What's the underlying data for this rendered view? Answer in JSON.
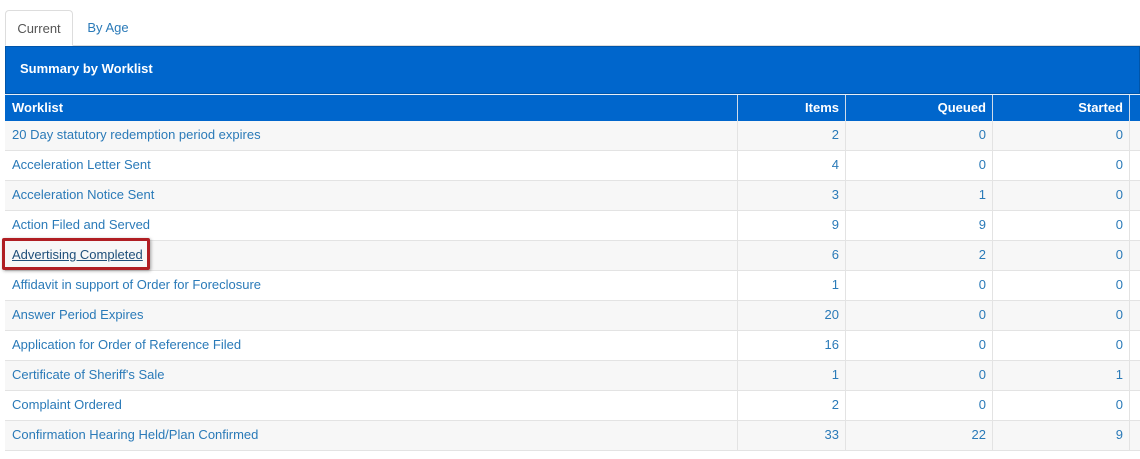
{
  "tabs": [
    {
      "label": "Current",
      "active": true
    },
    {
      "label": "By Age",
      "active": false
    }
  ],
  "panel": {
    "title": "Summary by Worklist"
  },
  "columns": [
    "Worklist",
    "Items",
    "Queued",
    "Started"
  ],
  "rows": [
    {
      "worklist": "20 Day statutory redemption period expires",
      "items": "2",
      "queued": "0",
      "started": "0"
    },
    {
      "worklist": "Acceleration Letter Sent",
      "items": "4",
      "queued": "0",
      "started": "0"
    },
    {
      "worklist": "Acceleration Notice Sent",
      "items": "3",
      "queued": "1",
      "started": "0"
    },
    {
      "worklist": "Action Filed and Served",
      "items": "9",
      "queued": "9",
      "started": "0"
    },
    {
      "worklist": "Advertising Completed",
      "items": "6",
      "queued": "2",
      "started": "0",
      "highlighted": true
    },
    {
      "worklist": "Affidavit in support of Order for Foreclosure",
      "items": "1",
      "queued": "0",
      "started": "0"
    },
    {
      "worklist": "Answer Period Expires",
      "items": "20",
      "queued": "0",
      "started": "0"
    },
    {
      "worklist": "Application for Order of Reference Filed",
      "items": "16",
      "queued": "0",
      "started": "0"
    },
    {
      "worklist": "Certificate of Sheriff's Sale",
      "items": "1",
      "queued": "0",
      "started": "1"
    },
    {
      "worklist": "Complaint Ordered",
      "items": "2",
      "queued": "0",
      "started": "0"
    },
    {
      "worklist": "Confirmation Hearing Held/Plan Confirmed",
      "items": "33",
      "queued": "22",
      "started": "9"
    }
  ],
  "colors": {
    "header_blue": "#0066cc",
    "link_blue": "#2a7ab8",
    "highlight_red": "#b01e23"
  }
}
